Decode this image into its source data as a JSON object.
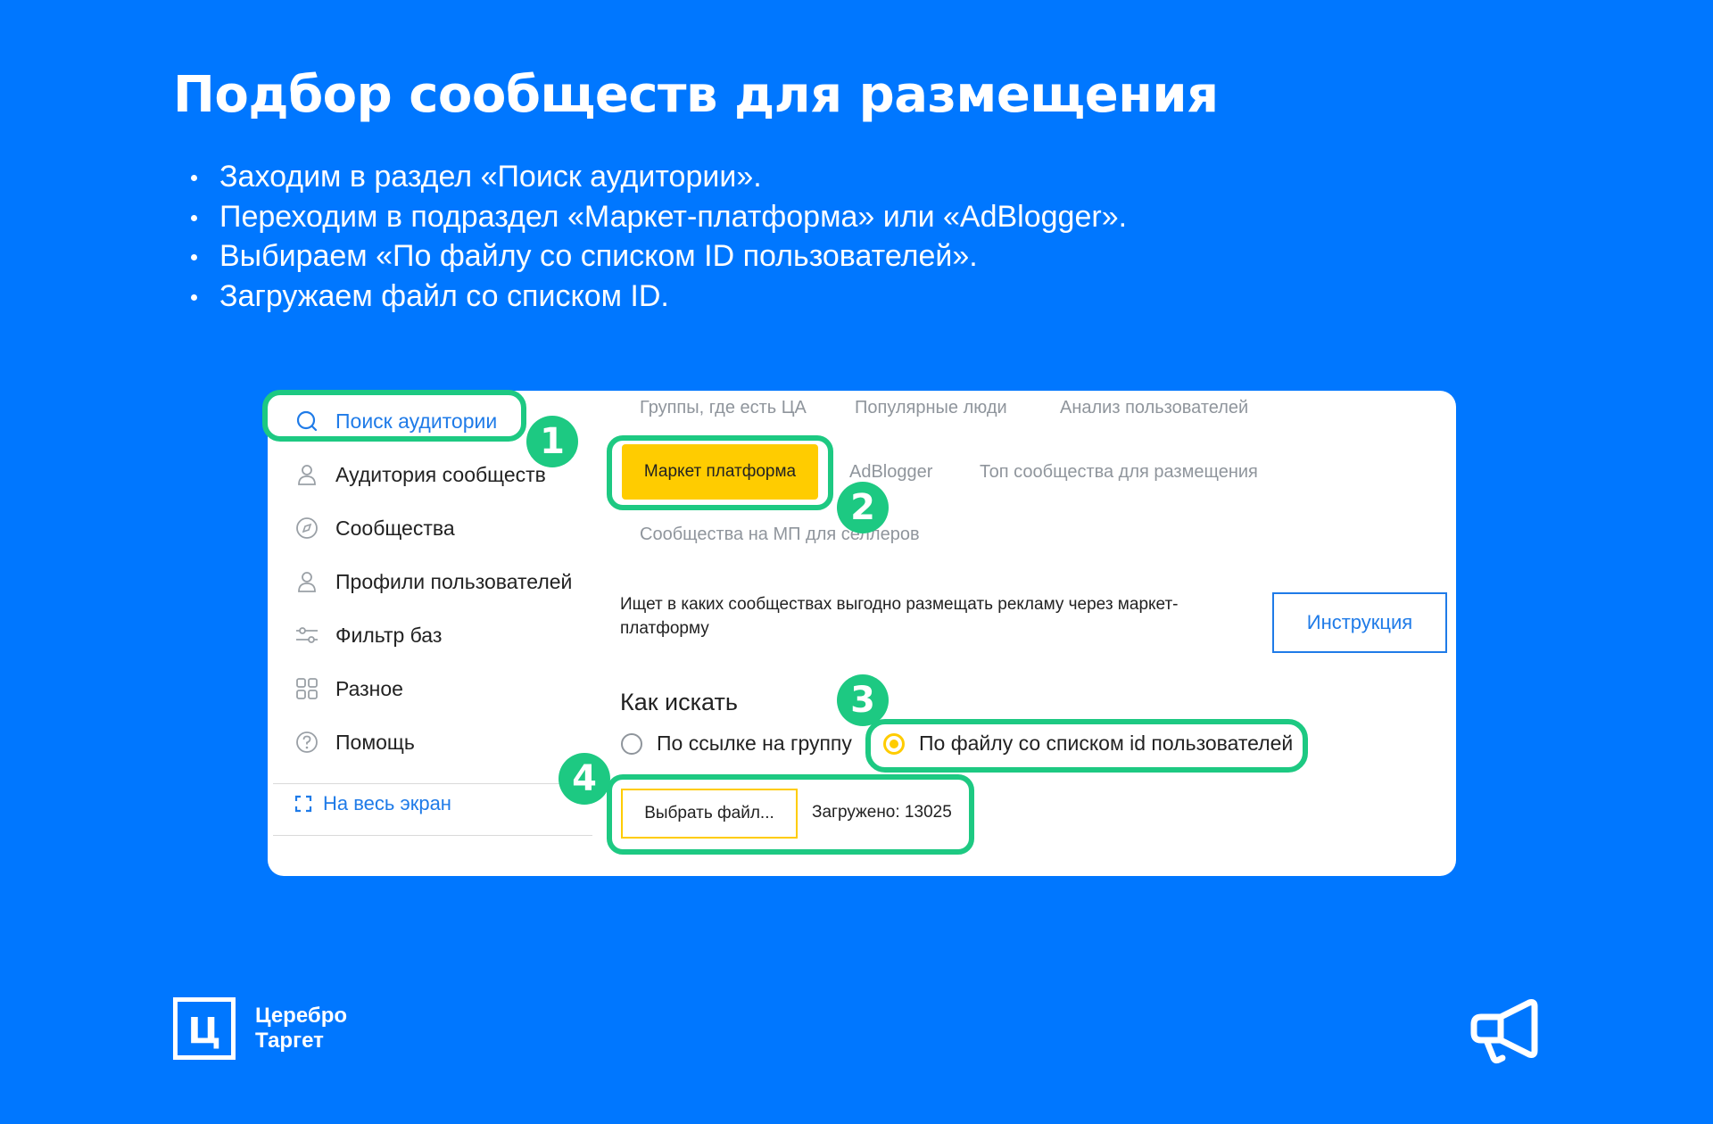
{
  "slide": {
    "title": "Подбор сообществ для размещения",
    "bullets": [
      "Заходим в раздел «Поиск аудитории».",
      "Переходим в подраздел «Маркет-платформа» или «AdBlogger».",
      "Выбираем «По файлу со списком ID пользователей».",
      "Загружаем файл со списком ID."
    ]
  },
  "sidebar": {
    "items": [
      {
        "label": "Поиск аудитории",
        "icon": "search-icon"
      },
      {
        "label": "Аудитория сообществ",
        "icon": "user-icon"
      },
      {
        "label": "Сообщества",
        "icon": "compass-icon"
      },
      {
        "label": "Профили пользователей",
        "icon": "user-icon"
      },
      {
        "label": "Фильтр баз",
        "icon": "sliders-icon"
      },
      {
        "label": "Разное",
        "icon": "grid-icon"
      },
      {
        "label": "Помощь",
        "icon": "help-icon"
      }
    ],
    "fullscreen_label": "На весь экран"
  },
  "tabs": {
    "row1": [
      "Группы, где есть ЦА",
      "Популярные люди",
      "Анализ пользователей"
    ],
    "active": "Маркет платформа",
    "row2": [
      "AdBlogger",
      "Топ сообщества для размещения"
    ],
    "row3": [
      "Сообщества на МП для селлеров"
    ]
  },
  "content": {
    "description": "Ищет в каких сообществах выгодно размещать рекламу через маркет-платформу",
    "instruction_button": "Инструкция",
    "how_to_search": "Как искать",
    "radio_link": "По ссылке на группу",
    "radio_file": "По файлу со списком id пользователей",
    "choose_file_button": "Выбрать файл...",
    "loaded_text": "Загружено: 13025"
  },
  "steps": [
    "1",
    "2",
    "3",
    "4"
  ],
  "brand": {
    "logo_letter": "Ц",
    "name_line1": "Церебро",
    "name_line2": "Таргет"
  },
  "colors": {
    "background": "#0077FF",
    "highlight": "#1DC982",
    "accent_yellow": "#FFCC00",
    "link_blue": "#1F7BE8"
  }
}
